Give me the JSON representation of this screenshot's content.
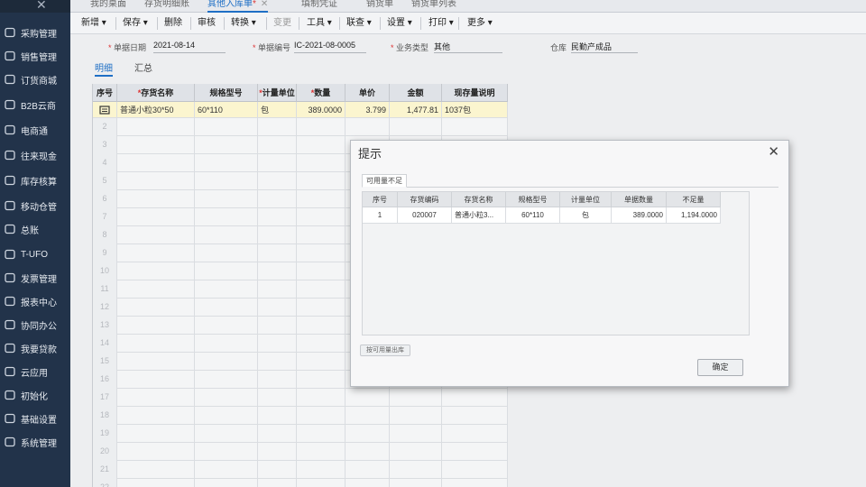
{
  "tabs": [
    {
      "label": "我的桌面"
    },
    {
      "label": "存货明细账"
    },
    {
      "label": "其他入库单",
      "active": true
    },
    {
      "label": "填制凭证"
    },
    {
      "label": "销货单"
    },
    {
      "label": "销货单列表"
    }
  ],
  "tab_modified_mark": "*",
  "tab_close": "✕",
  "sidebar": {
    "items": [
      {
        "label": "采购管理",
        "icon": "purchase-icon"
      },
      {
        "label": "销售管理",
        "icon": "sales-icon"
      },
      {
        "label": "订货商城",
        "icon": "order-mall-icon"
      },
      {
        "label": "B2B云商",
        "icon": "b2b-icon"
      },
      {
        "label": "电商通",
        "icon": "ecommerce-icon"
      },
      {
        "label": "往来现金",
        "icon": "cash-icon"
      },
      {
        "label": "库存核算",
        "icon": "inventory-icon"
      },
      {
        "label": "移动仓管",
        "icon": "mobile-warehouse-icon"
      },
      {
        "label": "总账",
        "icon": "ledger-icon"
      },
      {
        "label": "T-UFO",
        "icon": "ufo-icon"
      },
      {
        "label": "发票管理",
        "icon": "invoice-icon"
      },
      {
        "label": "报表中心",
        "icon": "report-icon"
      },
      {
        "label": "协同办公",
        "icon": "collab-icon"
      },
      {
        "label": "我要贷款",
        "icon": "loan-icon"
      },
      {
        "label": "云应用",
        "icon": "cloud-icon"
      },
      {
        "label": "初始化",
        "icon": "init-icon"
      },
      {
        "label": "基础设置",
        "icon": "settings-icon"
      },
      {
        "label": "系统管理",
        "icon": "system-icon"
      }
    ]
  },
  "toolbar": {
    "new": "新增",
    "save": "保存",
    "delete": "删除",
    "audit": "审核",
    "convert": "转换",
    "change": "变更",
    "tools": "工具",
    "query": "联查",
    "settings": "设置",
    "print": "打印",
    "more": "更多"
  },
  "form": {
    "date_label": "单据日期",
    "date_value": "2021-08-14",
    "no_label": "单据编号",
    "no_value": "IC-2021-08-0005",
    "type_label": "业务类型",
    "type_value": "其他",
    "warehouse_label": "仓库",
    "warehouse_value": "民勤产成品"
  },
  "subtabs": {
    "detail": "明细",
    "summary": "汇总"
  },
  "grid": {
    "headers": [
      "序号",
      "存货名称",
      "规格型号",
      "计量单位",
      "数量",
      "单价",
      "金额",
      "现存量说明"
    ],
    "required_mark": "*",
    "row1": {
      "name": "普通小粒30*50",
      "spec": "60*110",
      "unit": "包",
      "qty": "389.0000",
      "price": "3.799",
      "amount": "1,477.81",
      "note": "1037包"
    },
    "row_numbers": [
      "2",
      "3",
      "4",
      "5",
      "6",
      "7",
      "8",
      "9",
      "10",
      "11",
      "12",
      "13",
      "14",
      "15",
      "16",
      "17",
      "18",
      "19",
      "20",
      "21",
      "22"
    ]
  },
  "dialog": {
    "title": "提示",
    "tab": "可用量不足",
    "headers": [
      "序号",
      "存货编码",
      "存货名称",
      "规格型号",
      "计量单位",
      "单据数量",
      "不足量"
    ],
    "row": {
      "idx": "1",
      "code": "020007",
      "name": "普通小粒3...",
      "spec": "60*110",
      "unit": "包",
      "qty": "389.0000",
      "shortage": "1,194.0000"
    },
    "sub_button": "按可用量出库",
    "ok_button": "确定"
  }
}
